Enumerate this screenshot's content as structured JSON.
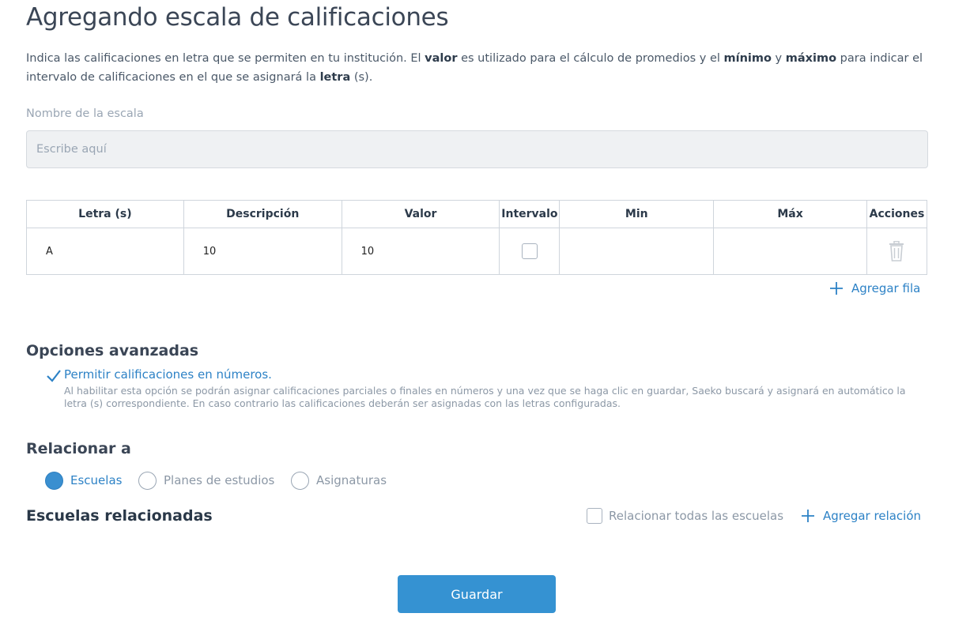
{
  "page": {
    "title": "Agregando escala de calificaciones",
    "intro": {
      "t1": "Indica las calificaciones en letra que se permiten en tu institución. El ",
      "b1": "valor",
      "t2": " es utilizado para el cálculo de promedios y el ",
      "b2": "mínimo",
      "t3": " y ",
      "b3": "máximo",
      "t4": " para indicar el intervalo de calificaciones en el que se asignará la ",
      "b4": "letra",
      "t5": " (s)."
    }
  },
  "scale_name": {
    "label": "Nombre de la escala",
    "placeholder": "Escribe aquí",
    "value": ""
  },
  "table": {
    "headers": [
      "Letra (s)",
      "Descripción",
      "Valor",
      "Intervalo",
      "Min",
      "Máx",
      "Acciones"
    ],
    "rows": [
      {
        "letra": "A",
        "descripcion": "10",
        "valor": "10",
        "intervalo": false,
        "min": "",
        "max": ""
      }
    ],
    "add_row_label": "Agregar fila"
  },
  "advanced": {
    "title": "Opciones avanzadas",
    "option_label": "Permitir calificaciones en números.",
    "option_checked": true,
    "option_description": "Al habilitar esta opción se podrán asignar calificaciones parciales o finales en números y una vez que se haga clic en guardar, Saeko buscará y asignará en automático la letra (s) correspondiente. En caso contrario las calificaciones deberán ser asignadas con las letras configuradas."
  },
  "relate": {
    "title": "Relacionar a",
    "options": [
      {
        "label": "Escuelas",
        "selected": true
      },
      {
        "label": "Planes de estudios",
        "selected": false
      },
      {
        "label": "Asignaturas",
        "selected": false
      }
    ]
  },
  "related_schools": {
    "title": "Escuelas relacionadas",
    "relate_all_label": "Relacionar todas las escuelas",
    "relate_all_checked": false,
    "add_relation_label": "Agregar relación"
  },
  "save_button": "Guardar",
  "colors": {
    "accent": "#3592d2",
    "link": "#2d82c6",
    "muted_text": "#9aa6b4"
  },
  "icons": [
    "check-icon",
    "trash-icon",
    "plus-icon"
  ]
}
